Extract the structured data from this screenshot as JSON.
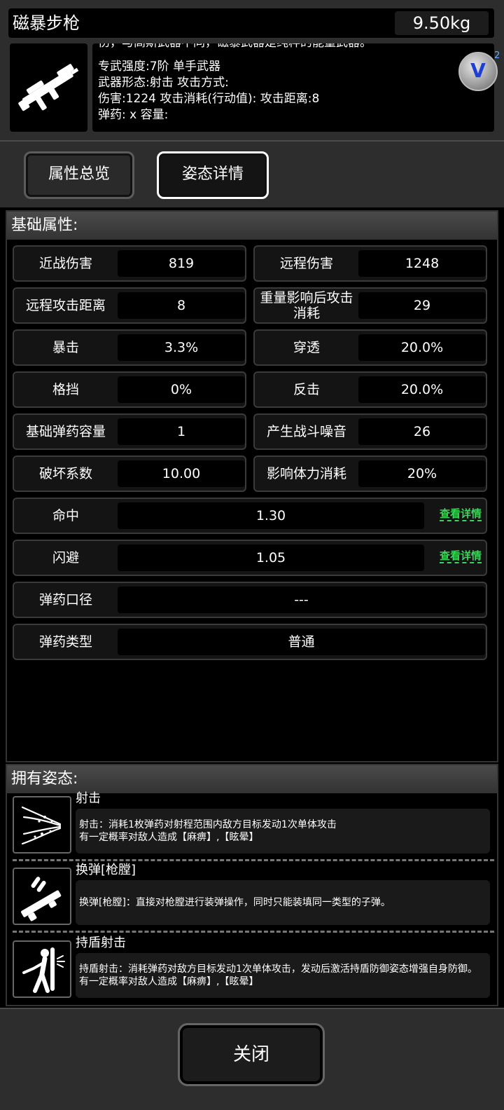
{
  "header": {
    "item_name": "磁暴步枪",
    "weight": "9.50kg",
    "description_lines": [
      "伤，与高斯武器不同，磁暴武器是纯粹的能量武器。",
      "专武强度:7阶 单手武器",
      "武器形态:射击 攻击方式:",
      " 伤害:1224 攻击消耗(行动值): 攻击距离:8",
      "弹药: x  容量:"
    ],
    "badge_letter": "V",
    "badge_number": "2"
  },
  "tabs": {
    "overview": "属性总览",
    "stance": "姿态详情"
  },
  "base_attributes": {
    "title": "基础属性:",
    "pairs": [
      {
        "left_label": "近战伤害",
        "left_value": "819",
        "right_label": "远程伤害",
        "right_value": "1248"
      },
      {
        "left_label": "远程攻击距离",
        "left_value": "8",
        "right_label": "重量影响后攻击消耗",
        "right_value": "29"
      },
      {
        "left_label": "暴击",
        "left_value": "3.3%",
        "right_label": "穿透",
        "right_value": "20.0%"
      },
      {
        "left_label": "格挡",
        "left_value": "0%",
        "right_label": "反击",
        "right_value": "20.0%"
      },
      {
        "left_label": "基础弹药容量",
        "left_value": "1",
        "right_label": "产生战斗噪音",
        "right_value": "26"
      },
      {
        "left_label": "破坏系数",
        "left_value": "10.00",
        "right_label": "影响体力消耗",
        "right_value": "20%"
      }
    ],
    "wide": [
      {
        "label": "命中",
        "value": "1.30",
        "link": "查看详情"
      },
      {
        "label": "闪避",
        "value": "1.05",
        "link": "查看详情"
      },
      {
        "label": "弹药口径",
        "value": "---"
      },
      {
        "label": "弹药类型",
        "value": "普通"
      }
    ]
  },
  "stances": {
    "title": "拥有姿态:",
    "items": [
      {
        "name": "射击",
        "icon": "spray-shot-icon",
        "desc_lines": [
          "射击：消耗1枚弹药对射程范围内敌方目标发动1次单体攻击",
          "有一定概率对敌人造成【麻痹】,【眩晕】"
        ]
      },
      {
        "name": "换弹[枪膛]",
        "icon": "reload-icon",
        "desc_lines": [
          "换弹[枪膛]：直接对枪膛进行装弹操作，同时只能装填同一类型的子弹。"
        ]
      },
      {
        "name": "持盾射击",
        "icon": "shield-shooter-icon",
        "desc_lines": [
          "持盾射击：消耗弹药对敌方目标发动1次单体攻击，发动后激活持盾防御姿态增强自身防御。",
          "有一定概率对敌人造成【麻痹】,【眩晕】"
        ]
      }
    ]
  },
  "footer": {
    "close_label": "关闭"
  }
}
